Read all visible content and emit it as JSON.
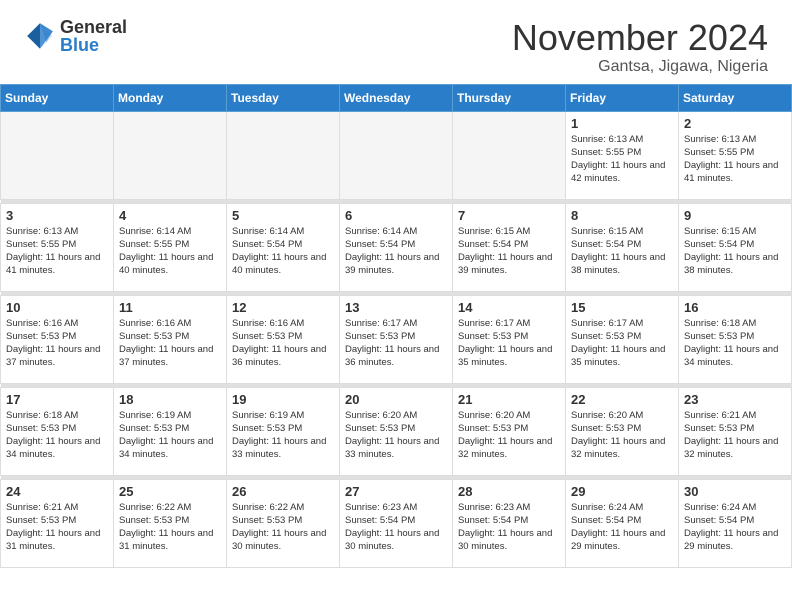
{
  "header": {
    "logo_general": "General",
    "logo_blue": "Blue",
    "month_title": "November 2024",
    "location": "Gantsa, Jigawa, Nigeria"
  },
  "weekdays": [
    "Sunday",
    "Monday",
    "Tuesday",
    "Wednesday",
    "Thursday",
    "Friday",
    "Saturday"
  ],
  "weeks": [
    [
      {
        "day": "",
        "empty": true
      },
      {
        "day": "",
        "empty": true
      },
      {
        "day": "",
        "empty": true
      },
      {
        "day": "",
        "empty": true
      },
      {
        "day": "",
        "empty": true
      },
      {
        "day": "1",
        "sunrise": "Sunrise: 6:13 AM",
        "sunset": "Sunset: 5:55 PM",
        "daylight": "Daylight: 11 hours and 42 minutes."
      },
      {
        "day": "2",
        "sunrise": "Sunrise: 6:13 AM",
        "sunset": "Sunset: 5:55 PM",
        "daylight": "Daylight: 11 hours and 41 minutes."
      }
    ],
    [
      {
        "day": "3",
        "sunrise": "Sunrise: 6:13 AM",
        "sunset": "Sunset: 5:55 PM",
        "daylight": "Daylight: 11 hours and 41 minutes."
      },
      {
        "day": "4",
        "sunrise": "Sunrise: 6:14 AM",
        "sunset": "Sunset: 5:55 PM",
        "daylight": "Daylight: 11 hours and 40 minutes."
      },
      {
        "day": "5",
        "sunrise": "Sunrise: 6:14 AM",
        "sunset": "Sunset: 5:54 PM",
        "daylight": "Daylight: 11 hours and 40 minutes."
      },
      {
        "day": "6",
        "sunrise": "Sunrise: 6:14 AM",
        "sunset": "Sunset: 5:54 PM",
        "daylight": "Daylight: 11 hours and 39 minutes."
      },
      {
        "day": "7",
        "sunrise": "Sunrise: 6:15 AM",
        "sunset": "Sunset: 5:54 PM",
        "daylight": "Daylight: 11 hours and 39 minutes."
      },
      {
        "day": "8",
        "sunrise": "Sunrise: 6:15 AM",
        "sunset": "Sunset: 5:54 PM",
        "daylight": "Daylight: 11 hours and 38 minutes."
      },
      {
        "day": "9",
        "sunrise": "Sunrise: 6:15 AM",
        "sunset": "Sunset: 5:54 PM",
        "daylight": "Daylight: 11 hours and 38 minutes."
      }
    ],
    [
      {
        "day": "10",
        "sunrise": "Sunrise: 6:16 AM",
        "sunset": "Sunset: 5:53 PM",
        "daylight": "Daylight: 11 hours and 37 minutes."
      },
      {
        "day": "11",
        "sunrise": "Sunrise: 6:16 AM",
        "sunset": "Sunset: 5:53 PM",
        "daylight": "Daylight: 11 hours and 37 minutes."
      },
      {
        "day": "12",
        "sunrise": "Sunrise: 6:16 AM",
        "sunset": "Sunset: 5:53 PM",
        "daylight": "Daylight: 11 hours and 36 minutes."
      },
      {
        "day": "13",
        "sunrise": "Sunrise: 6:17 AM",
        "sunset": "Sunset: 5:53 PM",
        "daylight": "Daylight: 11 hours and 36 minutes."
      },
      {
        "day": "14",
        "sunrise": "Sunrise: 6:17 AM",
        "sunset": "Sunset: 5:53 PM",
        "daylight": "Daylight: 11 hours and 35 minutes."
      },
      {
        "day": "15",
        "sunrise": "Sunrise: 6:17 AM",
        "sunset": "Sunset: 5:53 PM",
        "daylight": "Daylight: 11 hours and 35 minutes."
      },
      {
        "day": "16",
        "sunrise": "Sunrise: 6:18 AM",
        "sunset": "Sunset: 5:53 PM",
        "daylight": "Daylight: 11 hours and 34 minutes."
      }
    ],
    [
      {
        "day": "17",
        "sunrise": "Sunrise: 6:18 AM",
        "sunset": "Sunset: 5:53 PM",
        "daylight": "Daylight: 11 hours and 34 minutes."
      },
      {
        "day": "18",
        "sunrise": "Sunrise: 6:19 AM",
        "sunset": "Sunset: 5:53 PM",
        "daylight": "Daylight: 11 hours and 34 minutes."
      },
      {
        "day": "19",
        "sunrise": "Sunrise: 6:19 AM",
        "sunset": "Sunset: 5:53 PM",
        "daylight": "Daylight: 11 hours and 33 minutes."
      },
      {
        "day": "20",
        "sunrise": "Sunrise: 6:20 AM",
        "sunset": "Sunset: 5:53 PM",
        "daylight": "Daylight: 11 hours and 33 minutes."
      },
      {
        "day": "21",
        "sunrise": "Sunrise: 6:20 AM",
        "sunset": "Sunset: 5:53 PM",
        "daylight": "Daylight: 11 hours and 32 minutes."
      },
      {
        "day": "22",
        "sunrise": "Sunrise: 6:20 AM",
        "sunset": "Sunset: 5:53 PM",
        "daylight": "Daylight: 11 hours and 32 minutes."
      },
      {
        "day": "23",
        "sunrise": "Sunrise: 6:21 AM",
        "sunset": "Sunset: 5:53 PM",
        "daylight": "Daylight: 11 hours and 32 minutes."
      }
    ],
    [
      {
        "day": "24",
        "sunrise": "Sunrise: 6:21 AM",
        "sunset": "Sunset: 5:53 PM",
        "daylight": "Daylight: 11 hours and 31 minutes."
      },
      {
        "day": "25",
        "sunrise": "Sunrise: 6:22 AM",
        "sunset": "Sunset: 5:53 PM",
        "daylight": "Daylight: 11 hours and 31 minutes."
      },
      {
        "day": "26",
        "sunrise": "Sunrise: 6:22 AM",
        "sunset": "Sunset: 5:53 PM",
        "daylight": "Daylight: 11 hours and 30 minutes."
      },
      {
        "day": "27",
        "sunrise": "Sunrise: 6:23 AM",
        "sunset": "Sunset: 5:54 PM",
        "daylight": "Daylight: 11 hours and 30 minutes."
      },
      {
        "day": "28",
        "sunrise": "Sunrise: 6:23 AM",
        "sunset": "Sunset: 5:54 PM",
        "daylight": "Daylight: 11 hours and 30 minutes."
      },
      {
        "day": "29",
        "sunrise": "Sunrise: 6:24 AM",
        "sunset": "Sunset: 5:54 PM",
        "daylight": "Daylight: 11 hours and 29 minutes."
      },
      {
        "day": "30",
        "sunrise": "Sunrise: 6:24 AM",
        "sunset": "Sunset: 5:54 PM",
        "daylight": "Daylight: 11 hours and 29 minutes."
      }
    ]
  ]
}
